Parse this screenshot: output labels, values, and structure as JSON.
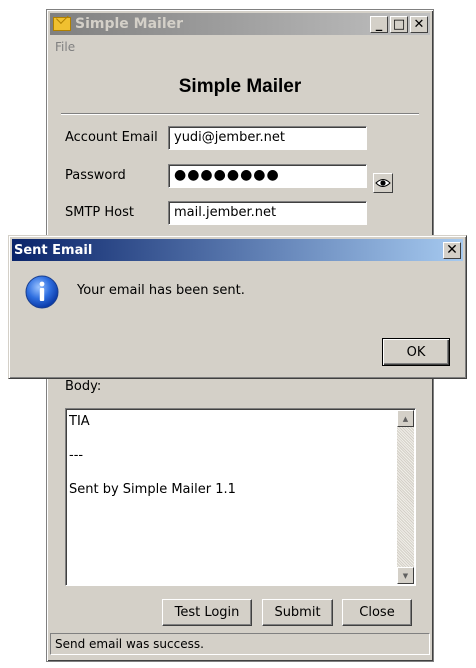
{
  "window": {
    "title": "Simple Mailer",
    "controls": {
      "minimize": "_",
      "maximize": "□",
      "close": "✕"
    }
  },
  "menu": {
    "file": "File"
  },
  "heading": "Simple Mailer",
  "form": {
    "account_email_label": "Account Email",
    "account_email_value": "yudi@jember.net",
    "password_label": "Password",
    "password_value": "●●●●●●●●",
    "smtp_host_label": "SMTP Host",
    "smtp_host_value": "mail.jember.net",
    "body_label": "Body:",
    "body_lines": [
      "TIA",
      "",
      "---",
      "",
      "Sent by Simple Mailer 1.1"
    ]
  },
  "buttons": {
    "test_login": "Test Login",
    "submit": "Submit",
    "close": "Close"
  },
  "status": "Send email was success.",
  "dialog": {
    "title": "Sent Email",
    "message": "Your email has been sent.",
    "ok": "OK",
    "close": "✕"
  },
  "icons": {
    "app": "envelope-icon",
    "show_password": "eye-icon",
    "info": "info-icon"
  },
  "colors": {
    "window_bg": "#d4d0c8",
    "dialog_title_start": "#0a246a",
    "dialog_title_end": "#a6caf0",
    "inactive_title_start": "#808080",
    "info_blue": "#1c5bd9"
  }
}
